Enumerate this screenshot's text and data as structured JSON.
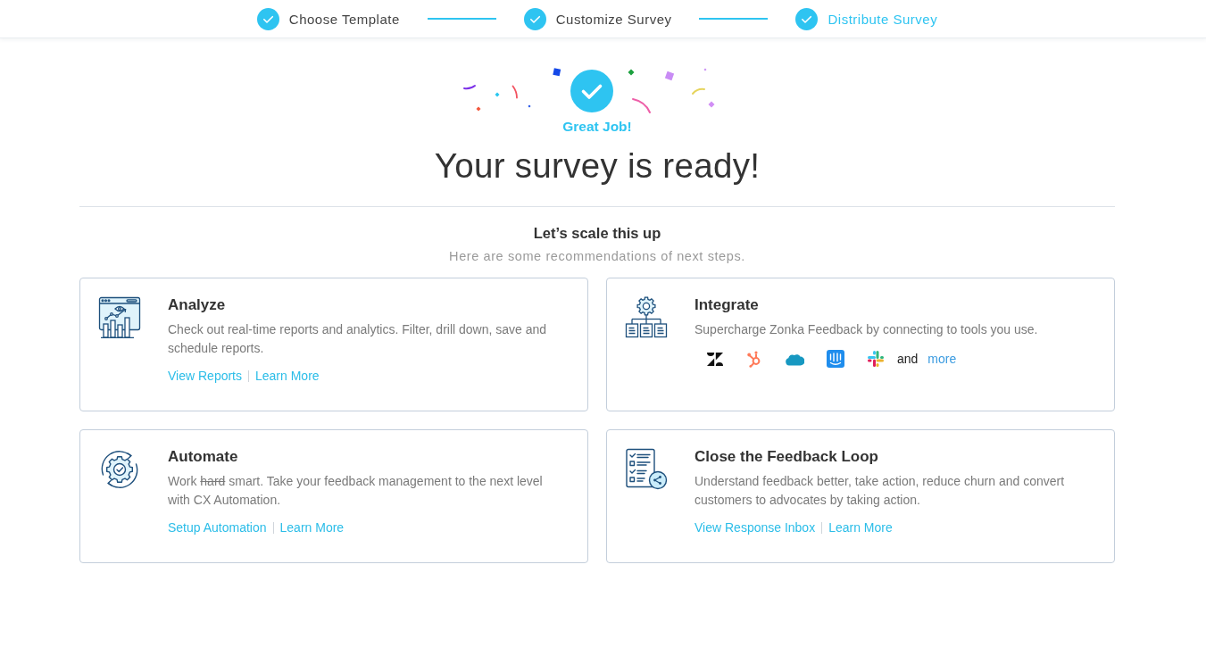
{
  "steps": [
    {
      "label": "Choose Template",
      "completed": true,
      "selected": false
    },
    {
      "label": "Customize Survey",
      "completed": true,
      "selected": false
    },
    {
      "label": "Distribute Survey",
      "completed": true,
      "selected": true
    }
  ],
  "confirmation": {
    "badge": "Great Job!",
    "title": "Your survey is ready!"
  },
  "recommendations": {
    "heading": "Let’s scale this up",
    "subheading": "Here are some recommendations of next steps."
  },
  "cards": [
    {
      "kind": "reports",
      "title": "Analyze",
      "description": [
        {
          "text": "Check out real-time reports and analytics. Filter, drill down, save and schedule reports.",
          "struck": false
        }
      ],
      "links": [
        "View Reports",
        "Learn More"
      ]
    },
    {
      "kind": "integrations",
      "title": "Integrate",
      "description": [
        {
          "text": "Supercharge Zonka Feedback by connecting to tools you use.",
          "struck": false
        }
      ],
      "integrations": {
        "note": "and",
        "link": "more"
      }
    },
    {
      "kind": "automation",
      "title": "Automate",
      "description": [
        {
          "text": "Work ",
          "struck": false
        },
        {
          "text": "hard",
          "struck": true
        },
        {
          "text": " smart. Take your feedback management to the next level with CX Automation.",
          "struck": false
        }
      ],
      "links": [
        "Setup Automation",
        "Learn More"
      ]
    },
    {
      "kind": "feedback_loop",
      "title": "Close the Feedback Loop",
      "description": [
        {
          "text": "Understand feedback better, take action, reduce churn and convert customers to advocates by taking action.",
          "struck": false
        }
      ],
      "links": [
        "View Response Inbox",
        "Learn More"
      ]
    }
  ]
}
